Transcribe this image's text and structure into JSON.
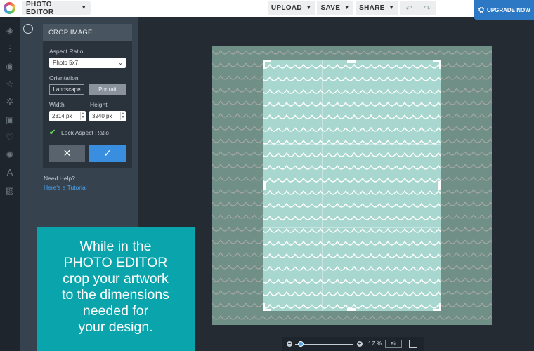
{
  "topbar": {
    "app_menu_label": "PHOTO EDITOR",
    "upload_label": "UPLOAD",
    "save_label": "SAVE",
    "share_label": "SHARE",
    "upgrade_label": "UPGRADE NOW"
  },
  "rail": {
    "icons": [
      "layers-icon",
      "adjust-icon",
      "eye-icon",
      "star-icon",
      "gear-icon",
      "frame-icon",
      "heart-icon",
      "badge-icon",
      "text-icon",
      "texture-icon"
    ],
    "active": "adjust-icon"
  },
  "crop_panel": {
    "title": "CROP IMAGE",
    "aspect_ratio_label": "Aspect Ratio",
    "aspect_ratio_value": "Photo 5x7",
    "orientation_label": "Orientation",
    "landscape_label": "Landscape",
    "portrait_label": "Portrait",
    "width_label": "Width",
    "height_label": "Height",
    "width_value": "2314 px",
    "height_value": "3240 px",
    "lock_label": "Lock Aspect Ratio",
    "lock_checked": true,
    "cancel_symbol": "✕",
    "apply_symbol": "✓"
  },
  "help": {
    "question": "Need Help?",
    "link": "Here's a Tutorial"
  },
  "zoom": {
    "value": "17 %",
    "fit_label": "Fit"
  },
  "callout": {
    "lines": [
      "While in the",
      "PHOTO EDITOR",
      "crop your artwork",
      "to the dimensions",
      "needed for",
      "your design."
    ]
  },
  "colors": {
    "canvas_bg": "#242b33",
    "panel": "#36424d",
    "accent_blue": "#3a8ee0",
    "callout_teal": "#0aa4ad",
    "pattern_mint": "#a8d7cf"
  }
}
